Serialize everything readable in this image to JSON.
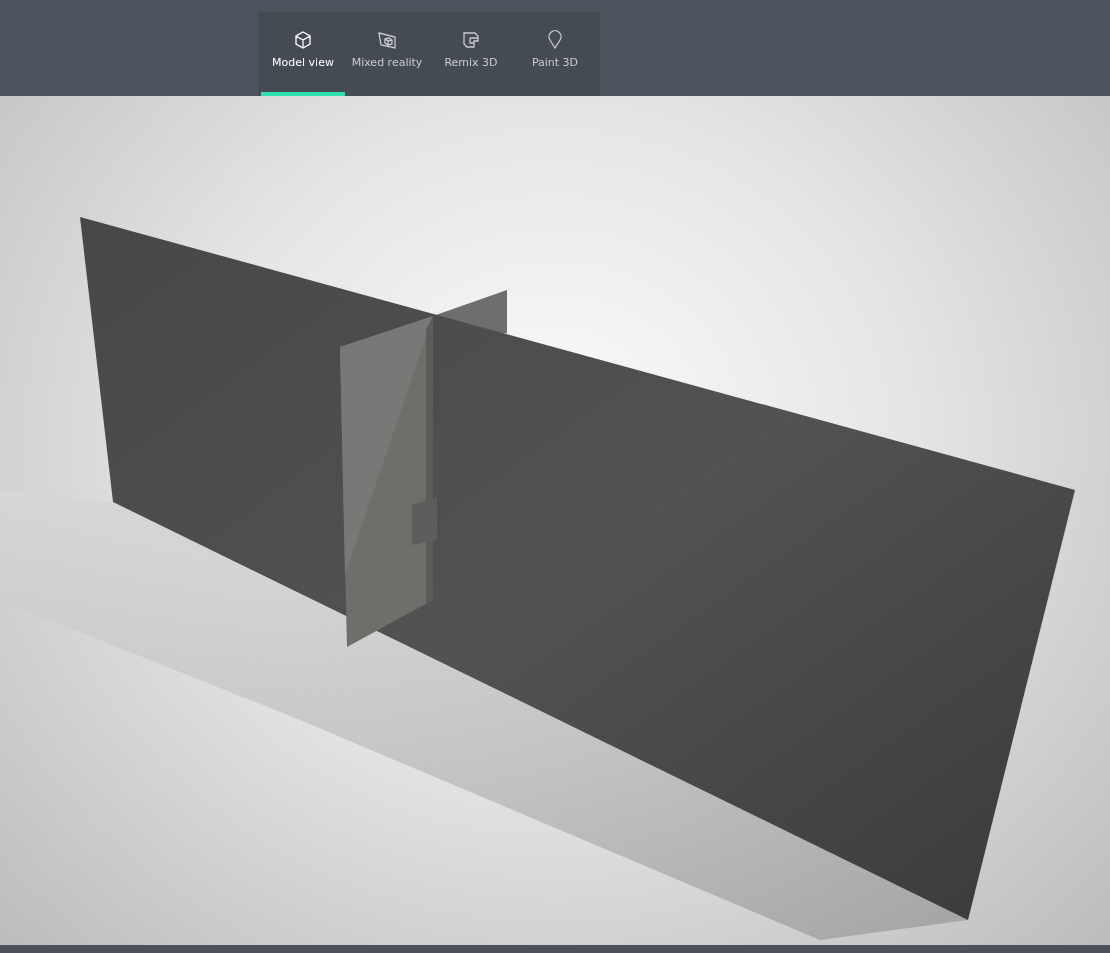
{
  "toolbar": {
    "tabs": [
      {
        "label": "Model view",
        "kind": "cube",
        "selected": true
      },
      {
        "label": "Mixed reality",
        "kind": "mixed",
        "selected": false
      },
      {
        "label": "Remix 3D",
        "kind": "remix",
        "selected": false
      },
      {
        "label": "Paint 3D",
        "kind": "paint",
        "selected": false
      }
    ]
  }
}
